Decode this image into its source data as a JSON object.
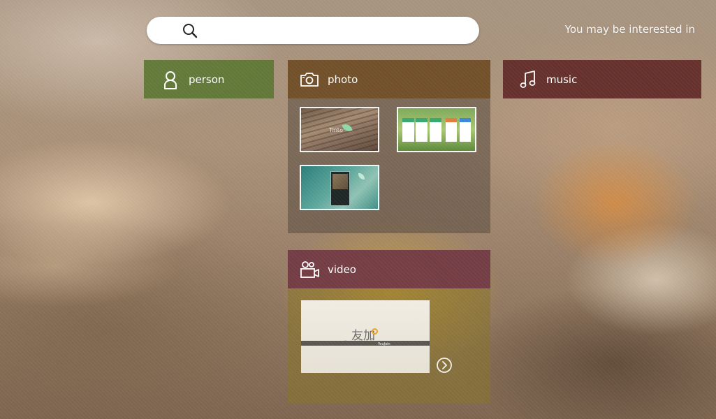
{
  "search": {
    "placeholder": "",
    "value": ""
  },
  "suggestions": {
    "label": "You may be interested in"
  },
  "person": {
    "title": "person",
    "icon": "person-icon",
    "color": "#5c7634"
  },
  "music": {
    "title": "music",
    "icon": "music-note-icon",
    "color": "#602826"
  },
  "photo": {
    "title": "photo",
    "icon": "camera-icon",
    "color": "#704e26",
    "thumbnails": [
      {
        "name": "wood-leaf-thumbnail",
        "caption": "Tinto"
      },
      {
        "name": "app-screens-thumbnail"
      },
      {
        "name": "main-window-thumbnail"
      }
    ]
  },
  "video": {
    "title": "video",
    "icon": "video-camera-icon",
    "color": "#703446",
    "thumbnail": {
      "logo": "友加",
      "tagline": "Connect with your friends",
      "brand": "YouJoin"
    }
  }
}
